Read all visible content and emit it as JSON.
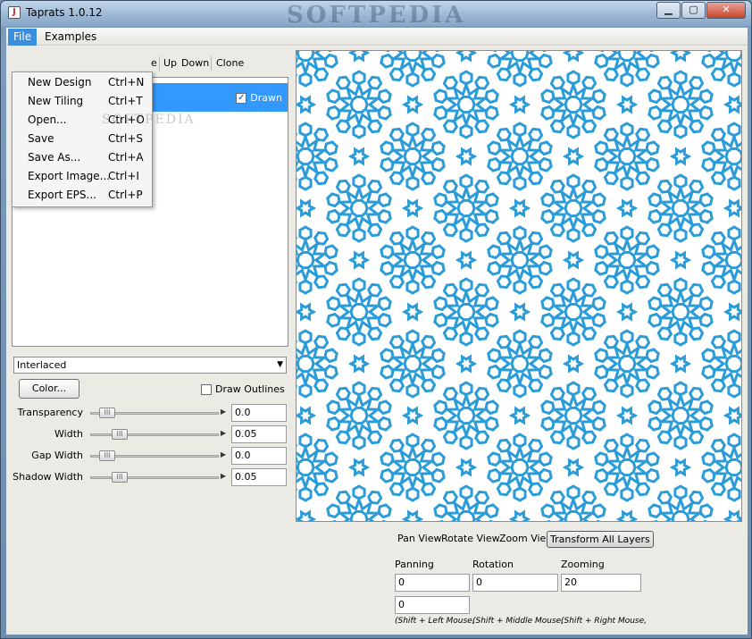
{
  "window": {
    "title": "Taprats 1.0.12",
    "watermark": "SOFTPEDIA",
    "app_icon_glyph": "J",
    "minimize_glyph": "▁",
    "maximize_glyph": "▢",
    "close_glyph": "✕"
  },
  "menubar": {
    "items": [
      {
        "label": "File"
      },
      {
        "label": "Examples"
      }
    ]
  },
  "file_menu": {
    "watermark": "SOFTPEDIA",
    "items": [
      {
        "label": "New Design",
        "shortcut": "Ctrl+N"
      },
      {
        "label": "New Tiling",
        "shortcut": "Ctrl+T"
      },
      {
        "label": "Open...",
        "shortcut": "Ctrl+O"
      },
      {
        "label": "Save",
        "shortcut": "Ctrl+S"
      },
      {
        "label": "Save As...",
        "shortcut": "Ctrl+A"
      },
      {
        "label": "Export Image...",
        "shortcut": "Ctrl+I"
      },
      {
        "label": "Export EPS...",
        "shortcut": "Ctrl+P"
      }
    ]
  },
  "toolbar": {
    "partial_label": "e",
    "up": "Up",
    "down": "Down",
    "clone": "Clone"
  },
  "layers": {
    "drawn_label": "Drawn",
    "drawn_checked": "✓",
    "selected_color": "#3399ff"
  },
  "style": {
    "render_mode": "Interlaced",
    "combo_arrow": "▼",
    "color_button": "Color...",
    "draw_outlines_label": "Draw Outlines",
    "sliders": [
      {
        "label": "Transparency",
        "value": "0.0",
        "fraction": 0.0
      },
      {
        "label": "Width",
        "value": "0.05",
        "fraction": 0.1
      },
      {
        "label": "Gap Width",
        "value": "0.0",
        "fraction": 0.0
      },
      {
        "label": "Shadow Width",
        "value": "0.05",
        "fraction": 0.1
      }
    ],
    "slider_grip": "III",
    "slider_end": "▶"
  },
  "pattern": {
    "stroke_color": "#2b9cd8",
    "background": "#ffffff"
  },
  "view_controls": {
    "options": [
      "Pan View",
      "Rotate View",
      "Zoom View"
    ],
    "active": "Transform All Layers",
    "panning_label": "Panning",
    "rotation_label": "Rotation",
    "zooming_label": "Zooming",
    "panning_x": "0",
    "panning_y": "0",
    "rotation": "0",
    "zooming": "20",
    "hints": [
      "(Shift + Left Mouse,",
      "(Shift + Middle Mouse,",
      "(Shift + Right Mouse,"
    ]
  }
}
